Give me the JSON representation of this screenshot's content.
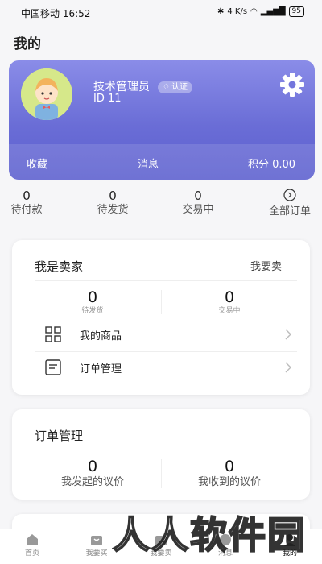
{
  "status_bar": {
    "carrier": "中国移动",
    "time": "16:52",
    "net_speed": "4 K/s",
    "battery": "95"
  },
  "page_title": "我的",
  "profile": {
    "name": "技术管理员",
    "badge": "认证",
    "id": "ID 11",
    "links": {
      "favorites": "收藏",
      "messages": "消息",
      "points": "积分 0.00"
    }
  },
  "order_summary": [
    {
      "count": "0",
      "label": "待付款"
    },
    {
      "count": "0",
      "label": "待发货"
    },
    {
      "count": "0",
      "label": "交易中"
    },
    {
      "label": "全部订单"
    }
  ],
  "seller": {
    "title": "我是卖家",
    "action": "我要卖",
    "stats": [
      {
        "count": "0",
        "label": "待发货"
      },
      {
        "count": "0",
        "label": "交易中"
      }
    ],
    "menu": [
      {
        "label": "我的商品",
        "icon": "grid-icon"
      },
      {
        "label": "订单管理",
        "icon": "list-icon"
      }
    ]
  },
  "bargain": {
    "title": "订单管理",
    "stats": [
      {
        "count": "0",
        "label": "我发起的议价"
      },
      {
        "count": "0",
        "label": "我收到的议价"
      }
    ]
  },
  "tabbar": [
    {
      "label": "首页",
      "icon": "home-icon"
    },
    {
      "label": "我要买",
      "icon": "bag-icon"
    },
    {
      "label": "我要卖",
      "icon": "sell-icon"
    },
    {
      "label": "消息",
      "icon": "message-icon"
    },
    {
      "label": "我的",
      "icon": "user-icon",
      "active": true
    }
  ],
  "watermark": "人人软件园",
  "colors": {
    "profile_gradient_top": "#8a8ce8",
    "profile_gradient_bottom": "#5c5fcf"
  }
}
